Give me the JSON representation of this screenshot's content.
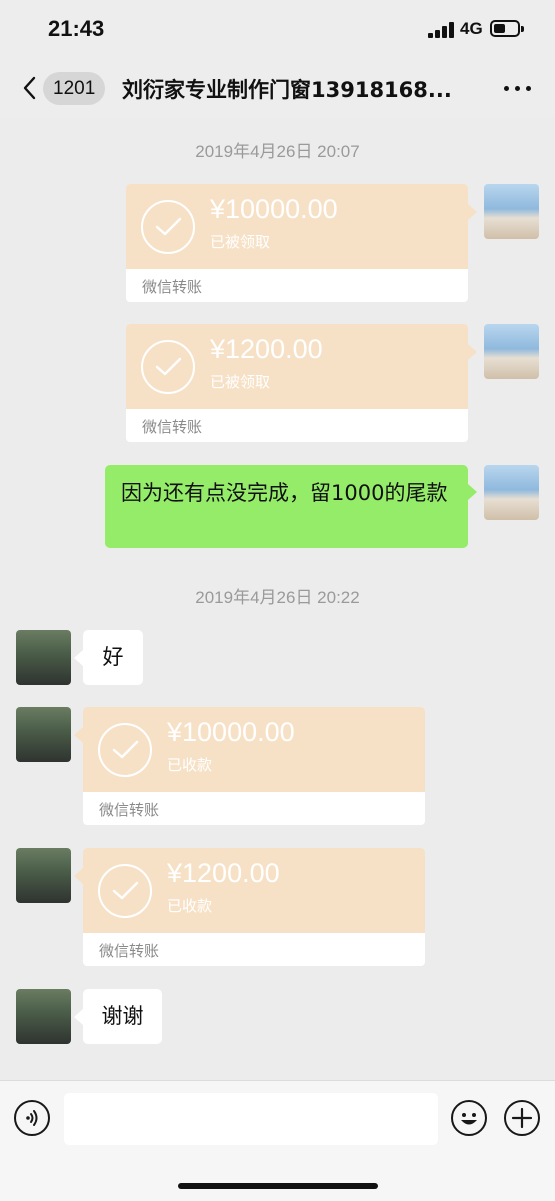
{
  "status_bar": {
    "time": "21:43",
    "network": "4G"
  },
  "nav": {
    "back_badge": "1201",
    "title": "刘衍家专业制作门窗13918168..."
  },
  "messages": {
    "ts1": "2019年4月26日 20:07",
    "transfer1": {
      "amount": "¥10000.00",
      "status": "已被领取",
      "footer": "微信转账"
    },
    "transfer2": {
      "amount": "¥1200.00",
      "status": "已被领取",
      "footer": "微信转账"
    },
    "text1": "因为还有点没完成，留1000的尾款",
    "ts2": "2019年4月26日 20:22",
    "reply1": "好",
    "transfer3": {
      "amount": "¥10000.00",
      "status": "已收款",
      "footer": "微信转账"
    },
    "transfer4": {
      "amount": "¥1200.00",
      "status": "已收款",
      "footer": "微信转账"
    },
    "reply2": "谢谢"
  },
  "input_bar": {
    "value": ""
  },
  "colors": {
    "transfer_bg": "#f7e1c6",
    "my_bubble": "#95ec69",
    "chat_bg": "#ececec"
  }
}
